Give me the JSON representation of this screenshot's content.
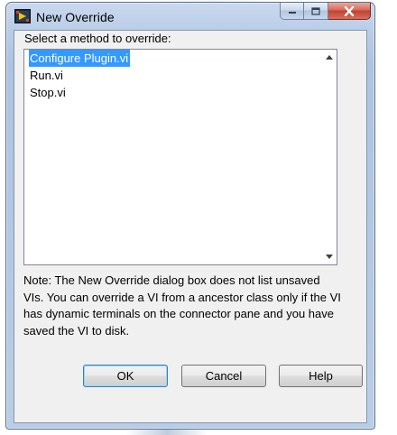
{
  "window": {
    "title": "New Override",
    "icon": "labview-override-icon"
  },
  "caption": {
    "minimize_icon": "minimize-icon",
    "maximize_icon": "maximize-icon",
    "close_icon": "close-icon"
  },
  "dialog": {
    "prompt": "Select a method to override:",
    "methods": [
      {
        "label": "Configure Plugin.vi",
        "selected": true
      },
      {
        "label": "Run.vi",
        "selected": false
      },
      {
        "label": "Stop.vi",
        "selected": false
      }
    ],
    "note": "Note: The New Override dialog box does not list unsaved VIs. You can override a VI from a ancestor class only if the VI has dynamic terminals on the connector pane and you have saved the VI to disk.",
    "buttons": {
      "ok": "OK",
      "cancel": "Cancel",
      "help": "Help"
    }
  },
  "colors": {
    "selection": "#3399ff",
    "close_button": "#c1412f",
    "frame": "#b9cde6"
  }
}
